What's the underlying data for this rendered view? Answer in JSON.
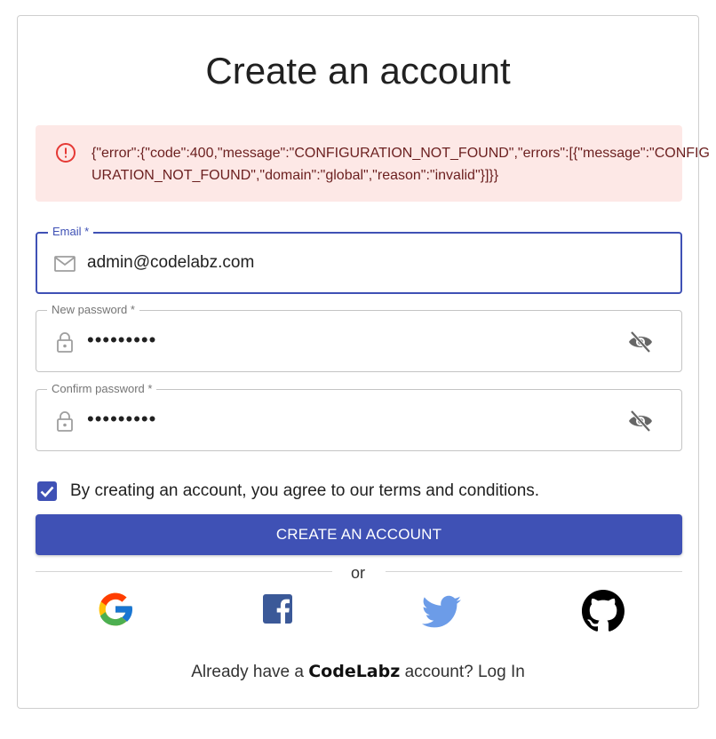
{
  "page": {
    "title": "Create an account"
  },
  "alert": {
    "message": "{\"error\":{\"code\":400,\"message\":\"CONFIGURATION_NOT_FOUND\",\"errors\":[{\"message\":\"CONFIGURATION_NOT_FOUND\",\"domain\":\"global\",\"reason\":\"invalid\"}]}}"
  },
  "form": {
    "email": {
      "label": "Email *",
      "value": "admin@codelabz.com",
      "icon": "mail-icon"
    },
    "new_password": {
      "label": "New password *",
      "value": "•••••••••",
      "icon": "lock-icon",
      "toggle_icon": "eye-off-icon"
    },
    "confirm_password": {
      "label": "Confirm password *",
      "value": "•••••••••",
      "icon": "lock-icon",
      "toggle_icon": "eye-off-icon"
    },
    "terms": {
      "checked": true,
      "label": "By creating an account, you agree to our terms and conditions."
    },
    "submit_label": "CREATE AN ACCOUNT"
  },
  "divider": {
    "label": "or"
  },
  "social": [
    {
      "name": "google",
      "icon": "google-icon"
    },
    {
      "name": "facebook",
      "icon": "facebook-icon",
      "color": "#3b5998"
    },
    {
      "name": "twitter",
      "icon": "twitter-icon",
      "color": "#6c9ce8"
    },
    {
      "name": "github",
      "icon": "github-icon",
      "color": "#000000"
    }
  ],
  "footer": {
    "prefix": "Already have a",
    "brand": "CodeLabz",
    "middle": "account?",
    "login_label": "Log In"
  },
  "colors": {
    "primary": "#3f51b5",
    "error_bg": "#fde8e6",
    "error_icon": "#e53935",
    "error_text": "#6b1f1f"
  }
}
